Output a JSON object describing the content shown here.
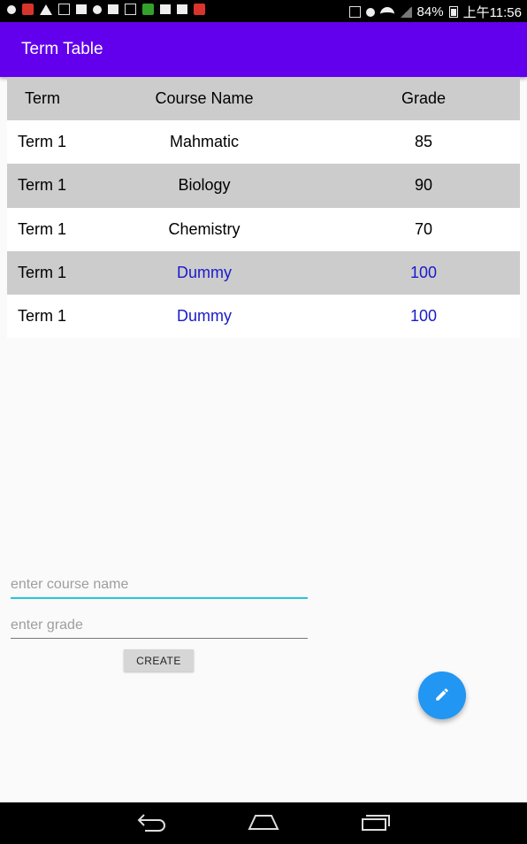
{
  "status_bar": {
    "battery": "84%",
    "time": "上午11:56"
  },
  "app_bar": {
    "title": "Term Table"
  },
  "table": {
    "headers": [
      "Term",
      "Course Name",
      "Grade"
    ],
    "rows": [
      {
        "term": "Term 1",
        "course": "Mahmatic",
        "grade": "85"
      },
      {
        "term": "Term 1",
        "course": "Biology",
        "grade": "90"
      },
      {
        "term": "Term 1",
        "course": "Chemistry",
        "grade": "70"
      },
      {
        "term": "Term 1",
        "course": "Dummy",
        "grade": "100"
      },
      {
        "term": "Term 1",
        "course": "Dummy",
        "grade": "100"
      }
    ]
  },
  "form": {
    "course_placeholder": "enter course name",
    "grade_placeholder": "enter grade",
    "create_label": "CREATE"
  },
  "fab": {
    "icon": "edit-pencil-icon"
  },
  "nav_bar": {
    "icons": [
      "back-icon",
      "home-icon",
      "recent-apps-icon"
    ]
  },
  "colors": {
    "primary": "#6200ee",
    "accent": "#26c6da",
    "fab": "#2196f3",
    "dummy_text": "#1a1acc",
    "row_grey": "#cccccc"
  }
}
